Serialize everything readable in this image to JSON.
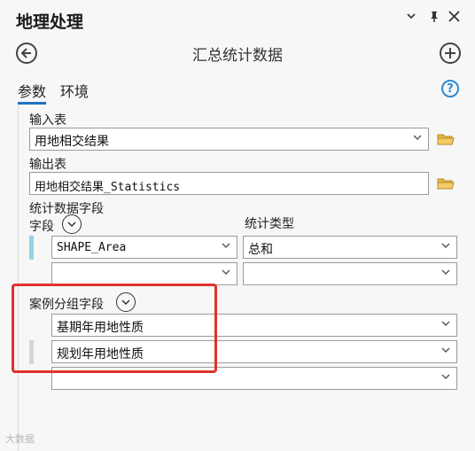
{
  "panel": {
    "title": "地理处理",
    "menu_icon": "chevron-down-icon",
    "pin_icon": "pin-icon",
    "close_icon": "close-icon"
  },
  "tool": {
    "title": "汇总统计数据",
    "back_icon": "back-arrow-icon",
    "add_icon": "plus-icon"
  },
  "tabs": [
    {
      "label": "参数",
      "active": true
    },
    {
      "label": "环境",
      "active": false
    }
  ],
  "help_label": "?",
  "input_table": {
    "label": "输入表",
    "value": "用地相交结果"
  },
  "output_table": {
    "label": "输出表",
    "value": "用地相交结果_Statistics"
  },
  "stat_fields": {
    "label": "统计数据字段",
    "field_label": "字段",
    "type_label": "统计类型",
    "rows": [
      {
        "field": "SHAPE_Area",
        "type": "总和"
      },
      {
        "field": "",
        "type": ""
      }
    ]
  },
  "case_fields": {
    "label": "案例分组字段",
    "rows": [
      "基期年用地性质",
      "规划年用地性质",
      ""
    ]
  },
  "colors": {
    "accent": "#1e73be",
    "highlight_box": "#e0322c",
    "row_marker_active": "#9ad0e6",
    "row_marker_inactive": "#d6d6d6",
    "folder": "#e8b84a"
  },
  "watermark": "大数据"
}
